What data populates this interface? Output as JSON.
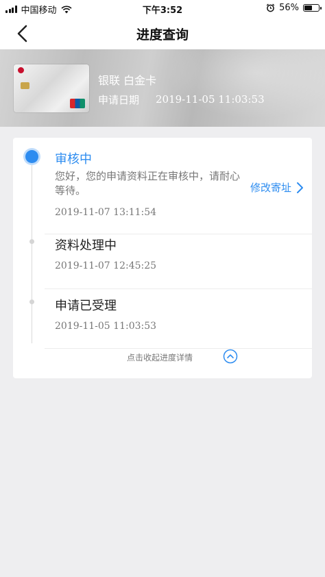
{
  "status_bar": {
    "carrier": "中国移动",
    "time": "下午3:52",
    "battery": "56%",
    "battery_level": 0.56
  },
  "nav": {
    "title": "进度查询"
  },
  "card": {
    "name": "银联 白金卡",
    "apply_label": "申请日期",
    "apply_date": "2019-11-05 11:03:53"
  },
  "steps": [
    {
      "title": "审核中",
      "desc": "您好，您的申请资料正在审核中，请耐心等待。",
      "time": "2019-11-07 13:11:54",
      "active": true
    },
    {
      "title": "资料处理中",
      "time": "2019-11-07 12:45:25",
      "active": false
    },
    {
      "title": "申请已受理",
      "time": "2019-11-05 11:03:53",
      "active": false
    }
  ],
  "actions": {
    "modify_address": "修改寄址",
    "collapse_details": "点击收起进度详情"
  },
  "colors": {
    "accent": "#2d8cf0",
    "background": "#eeeef0"
  },
  "icons": [
    "back-arrow-icon",
    "chevron-right-icon",
    "chevron-up-circle-icon",
    "wifi-icon",
    "alarm-icon",
    "battery-icon",
    "signal-icon"
  ]
}
